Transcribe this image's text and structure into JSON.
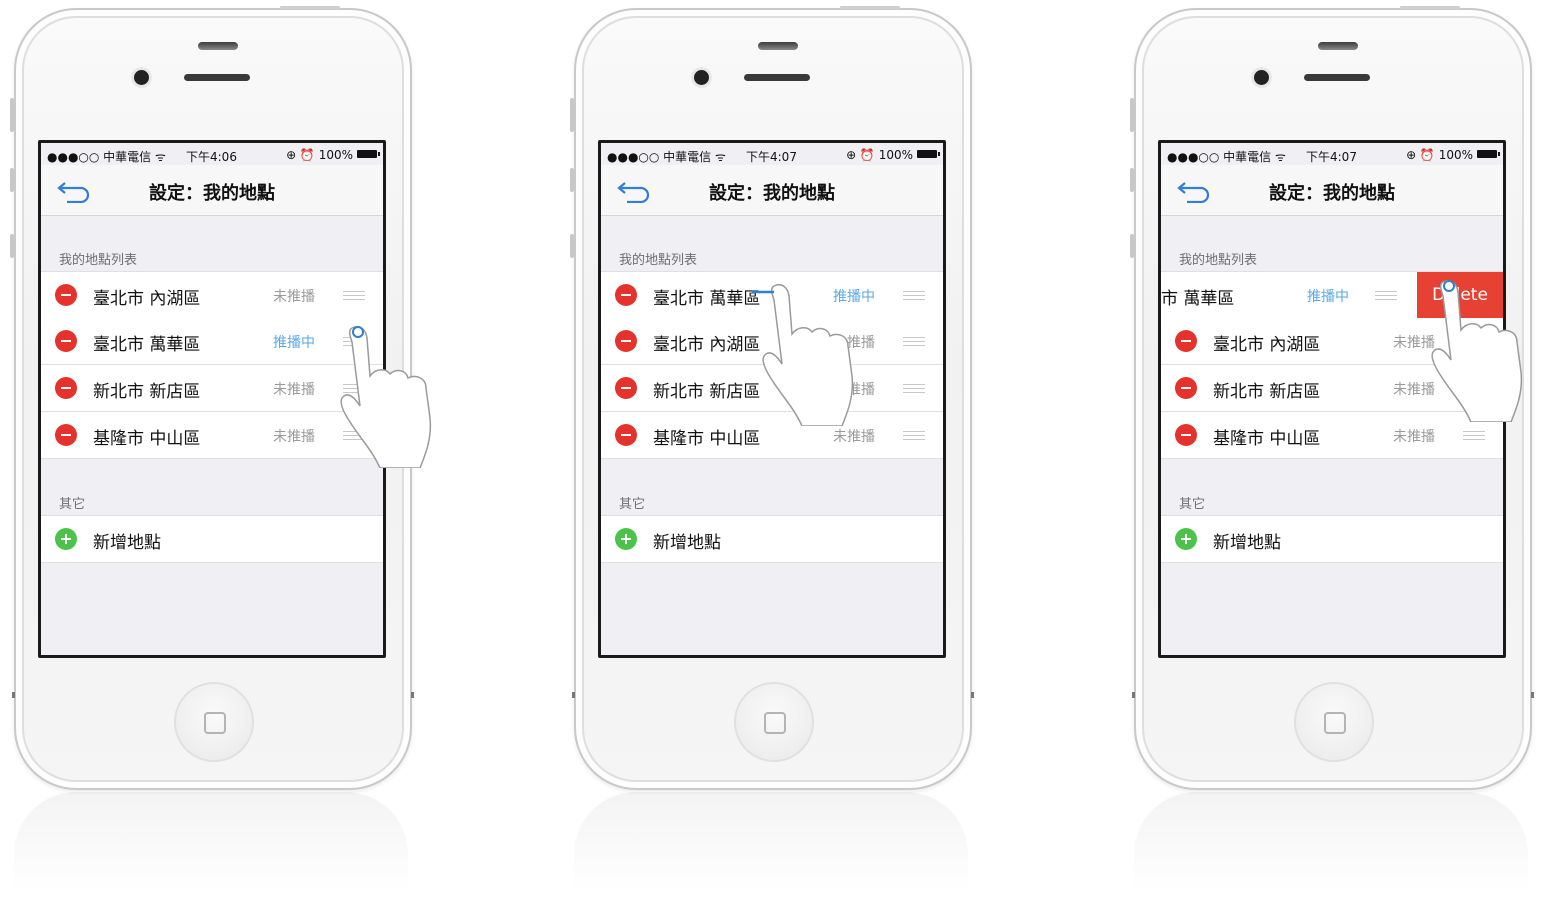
{
  "screens": [
    {
      "status": {
        "carrier": "●●●○○ 中華電信 ᯤ",
        "time": "下午4:06",
        "battery": "⊕ ⏰ 100%"
      },
      "title": "設定：我的地點",
      "section1": "我的地點列表",
      "rows": [
        {
          "label": "臺北市 內湖區",
          "status": "未推播"
        },
        {
          "label": "臺北市 萬華區",
          "status": "推播中"
        },
        {
          "label": "新北市 新店區",
          "status": "未推播"
        },
        {
          "label": "基隆市 中山區",
          "status": "未推播"
        }
      ],
      "section2": "其它",
      "add_label": "新增地點"
    },
    {
      "status": {
        "carrier": "●●●○○ 中華電信 ᯤ",
        "time": "下午4:07",
        "battery": "⊕ ⏰ 100%"
      },
      "title": "設定：我的地點",
      "section1": "我的地點列表",
      "rows": [
        {
          "label": "臺北市 萬華區",
          "status": "推播中"
        },
        {
          "label": "臺北市 內湖區",
          "status": "未推播"
        },
        {
          "label": "新北市 新店區",
          "status": "未推播"
        },
        {
          "label": "基隆市 中山區",
          "status": "未推播"
        }
      ],
      "section2": "其它",
      "add_label": "新增地點"
    },
    {
      "status": {
        "carrier": "●●●○○ 中華電信 ᯤ",
        "time": "下午4:07",
        "battery": "⊕ ⏰ 100%"
      },
      "title": "設定：我的地點",
      "section1": "我的地點列表",
      "slid_row": {
        "label": "市 萬華區",
        "status": "推播中",
        "delete_label": "Delete"
      },
      "rows": [
        {
          "label": "臺北市 內湖區",
          "status": "未推播"
        },
        {
          "label": "新北市 新店區",
          "status": "未推播"
        },
        {
          "label": "基隆市 中山區",
          "status": "未推播"
        }
      ],
      "section2": "其它",
      "add_label": "新增地點"
    }
  ],
  "icons": {
    "back": "back-arrow-icon",
    "remove": "minus-circle-icon",
    "add": "plus-circle-icon",
    "reorder": "reorder-grip-icon",
    "hand": "hand-pointer-icon",
    "home": "home-button-icon"
  },
  "colors": {
    "delete": "#e74134",
    "active": "#5aa9e6",
    "remove": "#e5322d",
    "add": "#4cc24a",
    "back": "#2f7fd4"
  }
}
